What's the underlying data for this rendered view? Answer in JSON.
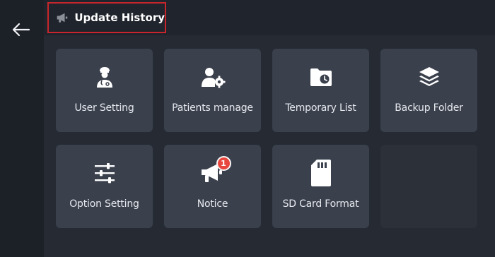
{
  "header": {
    "title": "Update History",
    "icon": "megaphone-icon"
  },
  "nav": {
    "back_icon": "arrow-left-icon"
  },
  "tiles": [
    {
      "label": "User Setting",
      "icon": "doctor-user-icon"
    },
    {
      "label": "Patients manage",
      "icon": "user-gear-icon"
    },
    {
      "label": "Temporary List",
      "icon": "folder-clock-icon"
    },
    {
      "label": "Backup Folder",
      "icon": "layers-icon"
    },
    {
      "label": "Option Setting",
      "icon": "sliders-icon"
    },
    {
      "label": "Notice",
      "icon": "megaphone-icon",
      "badge": "1"
    },
    {
      "label": "SD Card Format",
      "icon": "sd-card-icon"
    }
  ],
  "colors": {
    "accent_red": "#c8262c",
    "badge_red": "#e8473f",
    "tile_bg": "#3a404c",
    "page_bg": "#252a33"
  }
}
